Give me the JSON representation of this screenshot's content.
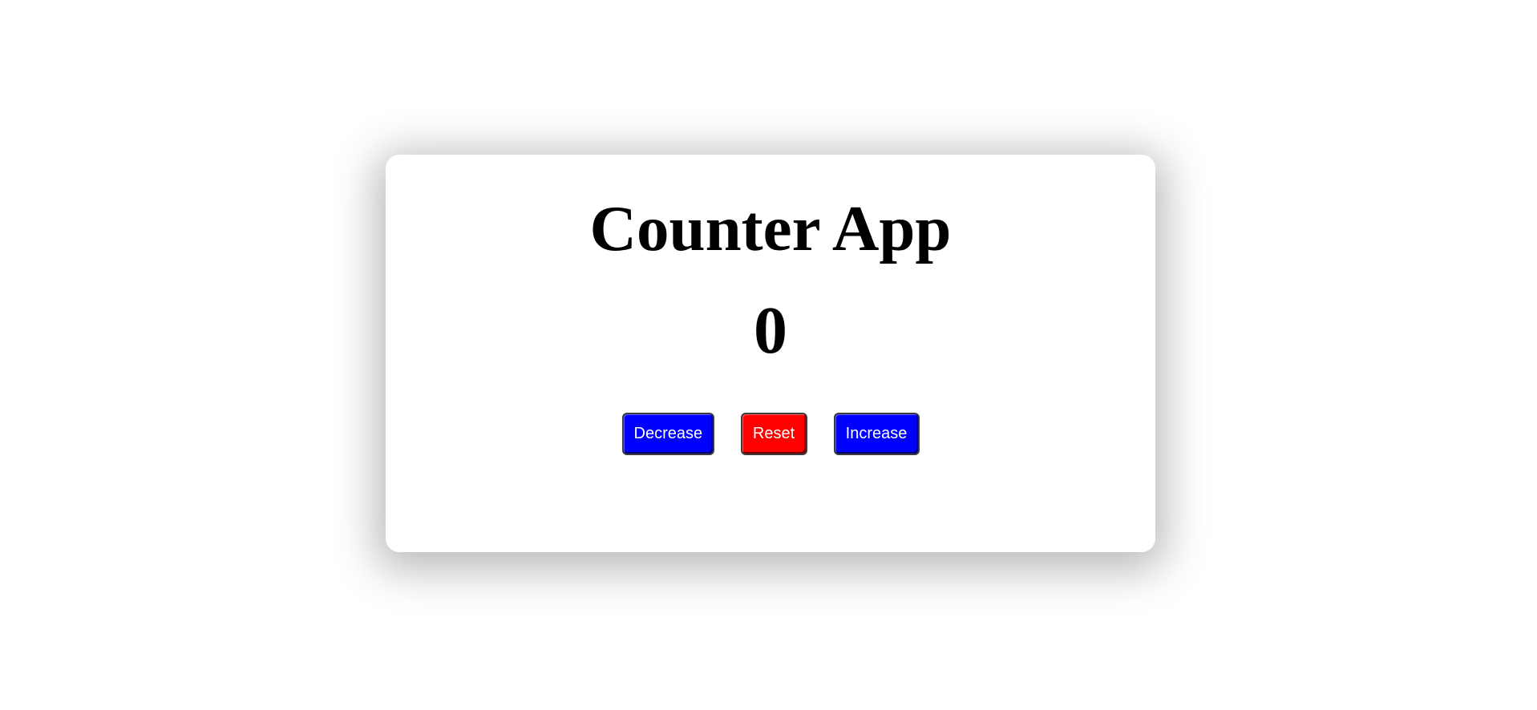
{
  "app": {
    "title": "Counter App",
    "count": "0"
  },
  "buttons": {
    "decrease_label": "Decrease",
    "reset_label": "Reset",
    "increase_label": "Increase"
  },
  "colors": {
    "decrease": "#0000ff",
    "reset": "#ff0000",
    "increase": "#0000ff",
    "text": "#000000",
    "button_text": "#ffffff"
  }
}
